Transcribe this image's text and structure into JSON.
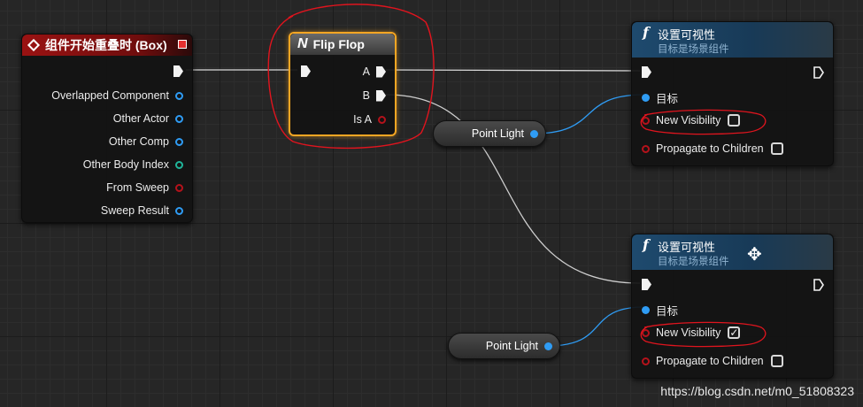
{
  "event_node": {
    "title": "组件开始重叠时 (Box)",
    "pins": [
      {
        "label": "Overlapped Component",
        "icon": "object-pin-icon"
      },
      {
        "label": "Other Actor",
        "icon": "object-pin-icon"
      },
      {
        "label": "Other Comp",
        "icon": "object-pin-icon"
      },
      {
        "label": "Other Body Index",
        "icon": "integer-pin-icon"
      },
      {
        "label": "From Sweep",
        "icon": "bool-pin-icon"
      },
      {
        "label": "Sweep Result",
        "icon": "struct-pin-icon"
      }
    ]
  },
  "flipflop_node": {
    "title": "Flip Flop",
    "out_a": "A",
    "out_b": "B",
    "is_a": "Is A"
  },
  "set_vis_1": {
    "title": "设置可视性",
    "subtitle": "目标是场景组件",
    "target_label": "目标",
    "new_visibility_label": "New Visibility",
    "new_visibility_checked": false,
    "propagate_label": "Propagate to Children",
    "propagate_checked": false
  },
  "set_vis_2": {
    "title": "设置可视性",
    "subtitle": "目标是场景组件",
    "target_label": "目标",
    "new_visibility_label": "New Visibility",
    "new_visibility_checked": true,
    "propagate_label": "Propagate to Children",
    "propagate_checked": false
  },
  "var_1": {
    "label": "Point Light"
  },
  "var_2": {
    "label": "Point Light"
  },
  "watermark": "https://blog.csdn.net/m0_51808323",
  "colors": {
    "event_header": "#8a1010",
    "function_header": "#1c3f5e",
    "flipflop_highlight": "#f5a623",
    "object_pin": "#2f9cf4",
    "bool_pin": "#b5121b",
    "int_pin": "#20b59a",
    "annotation": "#e0141e"
  }
}
